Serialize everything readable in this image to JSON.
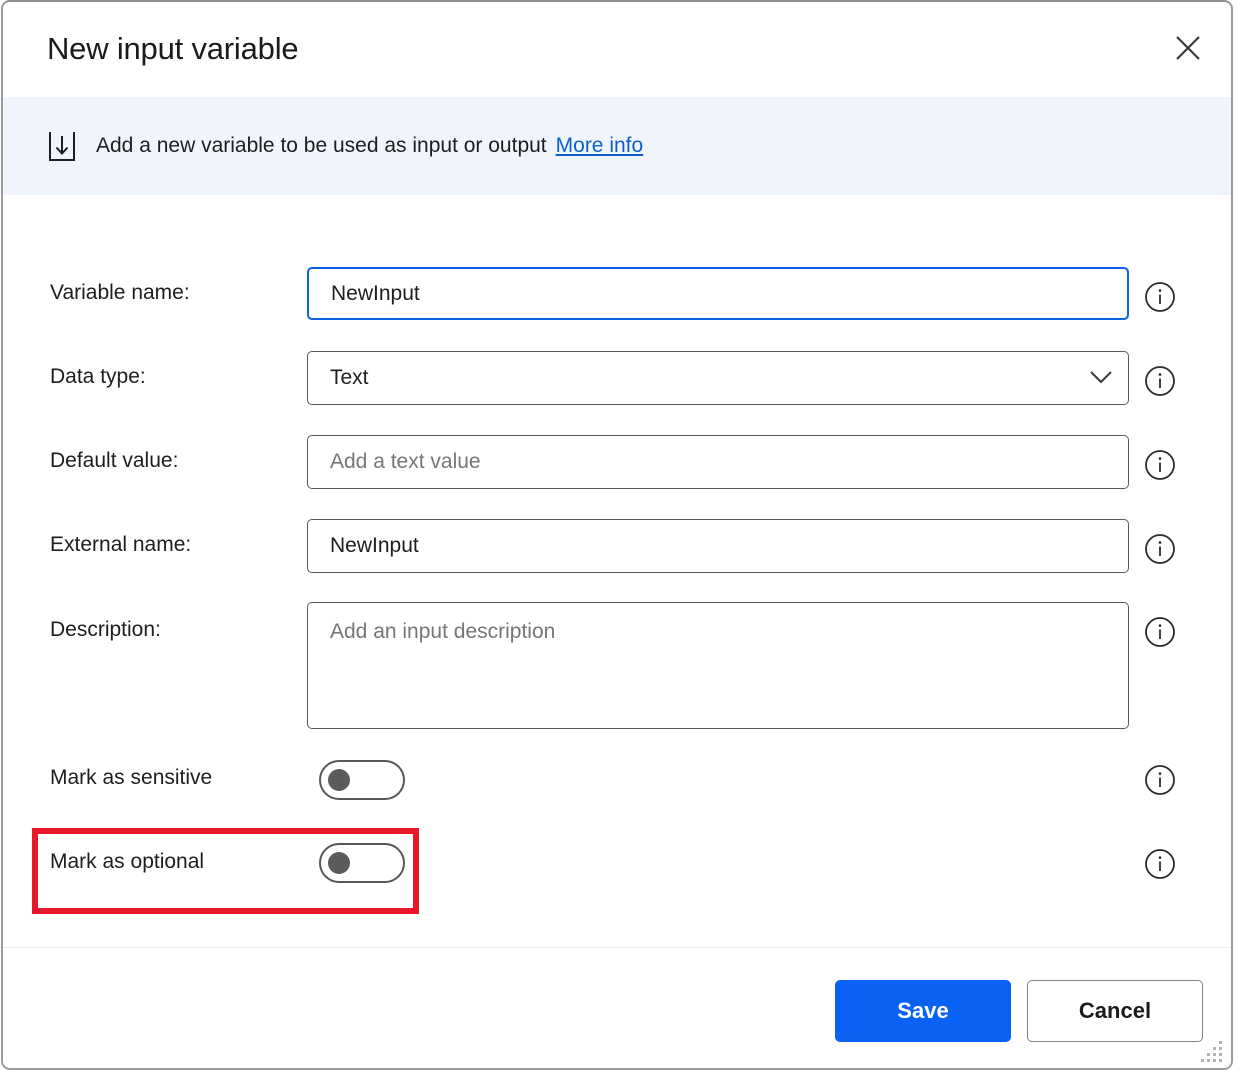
{
  "dialog": {
    "title": "New input variable",
    "close_label": "Close",
    "close_icon": "close-icon"
  },
  "banner": {
    "icon": "input-variable-icon",
    "text": "Add a new variable to be used as input or output",
    "link_label": "More info"
  },
  "form": {
    "info_icon": "info-icon",
    "fields": [
      {
        "label": "Variable name:",
        "type": "text",
        "value": "NewInput",
        "placeholder": "",
        "focused": true
      },
      {
        "label": "Data type:",
        "type": "select",
        "value": "Text",
        "placeholder": "",
        "focused": false,
        "chevron_icon": "chevron-down-icon"
      },
      {
        "label": "Default value:",
        "type": "text",
        "value": "",
        "placeholder": "Add a text value",
        "focused": false
      },
      {
        "label": "External name:",
        "type": "text",
        "value": "NewInput",
        "placeholder": "",
        "focused": false
      },
      {
        "label": "Description:",
        "type": "textarea",
        "value": "",
        "placeholder": "Add an input description",
        "focused": false
      }
    ],
    "toggles": [
      {
        "label": "Mark as sensitive",
        "state": "off",
        "highlighted": false
      },
      {
        "label": "Mark as optional",
        "state": "off",
        "highlighted": true
      }
    ]
  },
  "footer": {
    "save_label": "Save",
    "cancel_label": "Cancel"
  },
  "annotation": {
    "type": "rectangle-highlight",
    "color": "#e8182a",
    "target": "Mark as optional"
  },
  "colors": {
    "accent": "#0a62f5",
    "banner_bg": "#eff4fd",
    "link": "#0f5ecb",
    "focus_border": "#0a62e0",
    "highlight": "#e8182a"
  }
}
